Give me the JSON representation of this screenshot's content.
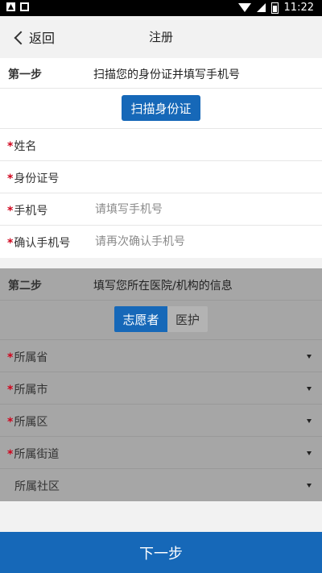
{
  "status_bar": {
    "time": "11:22"
  },
  "nav": {
    "back_label": "返回",
    "title": "注册"
  },
  "step1": {
    "label": "第一步",
    "description": "扫描您的身份证并填写手机号",
    "scan_button": "扫描身份证",
    "fields": {
      "name": {
        "label": "姓名",
        "required": "*",
        "value": ""
      },
      "id_number": {
        "label": "身份证号",
        "required": "*",
        "value": ""
      },
      "phone": {
        "label": "手机号",
        "required": "*",
        "placeholder": "请填写手机号"
      },
      "confirm_phone": {
        "label": "确认手机号",
        "required": "*",
        "placeholder": "请再次确认手机号"
      }
    }
  },
  "step2": {
    "label": "第二步",
    "description": "填写您所在医院/机构的信息",
    "segment": {
      "selected": "志愿者",
      "options": [
        "志愿者",
        "医护"
      ]
    },
    "selects": {
      "province": {
        "label": "所属省",
        "required": "*"
      },
      "city": {
        "label": "所属市",
        "required": "*"
      },
      "district": {
        "label": "所属区",
        "required": "*"
      },
      "street": {
        "label": "所属街道",
        "required": "*"
      },
      "community": {
        "label": "所属社区",
        "required": ""
      }
    }
  },
  "footer": {
    "next_button": "下一步"
  },
  "colors": {
    "primary": "#1668b8",
    "required": "#d0021b",
    "disabled_overlay": "#a6a6a6"
  }
}
